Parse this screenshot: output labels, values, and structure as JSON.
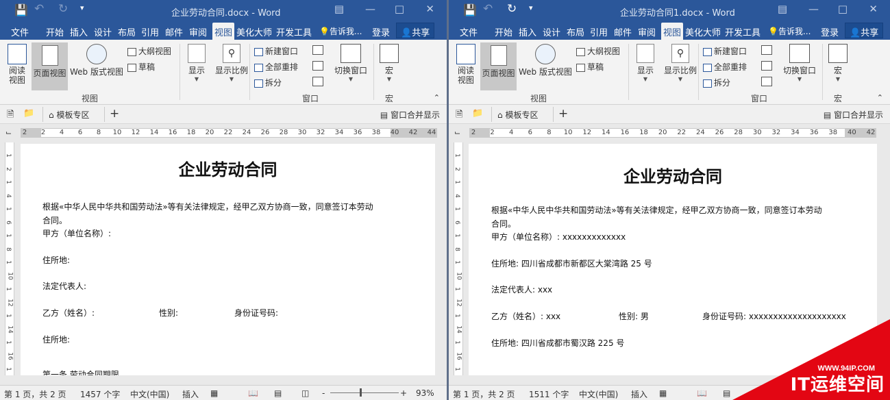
{
  "colors": {
    "brand": "#2b579a",
    "watermark": "#e30613"
  },
  "windows": [
    {
      "title": "企业劳动合同.docx - Word",
      "redo_enabled": false,
      "tabs": [
        "文件",
        "开始",
        "插入",
        "设计",
        "布局",
        "引用",
        "邮件",
        "审阅",
        "视图",
        "美化大师",
        "开发工具"
      ],
      "active_tab": "视图",
      "tell_me": "告诉我...",
      "login": "登录",
      "share": "共享",
      "ribbon": {
        "read_view": "阅读\n视图",
        "page_view": "页面视图",
        "web_view": "Web 版式视图",
        "outline": "大纲视图",
        "draft": "草稿",
        "views_group": "视图",
        "show": "显示",
        "zoom": "显示比例",
        "new_window": "新建窗口",
        "arrange_all": "全部重排",
        "split": "拆分",
        "switch_window": "切换窗口",
        "window_group": "窗口",
        "macro": "宏",
        "macro_group": "宏"
      },
      "docbar": {
        "template_zone": "模板专区",
        "merge": "窗口合并显示"
      },
      "ruler_ticks": [
        "2",
        "2",
        "4",
        "6",
        "8",
        "10",
        "12",
        "14",
        "16",
        "18",
        "20",
        "22",
        "24",
        "26",
        "28",
        "30",
        "32",
        "34",
        "36",
        "38",
        "40",
        "42",
        "44"
      ],
      "vruler_ticks": [
        "1",
        "2",
        "1",
        "4",
        "1",
        "6",
        "1",
        "8",
        "1",
        "10",
        "1",
        "12",
        "1",
        "14",
        "1",
        "16",
        "1"
      ],
      "doc": {
        "title": "企业劳动合同",
        "intro1": "根据«中华人民中华共和国劳动法»等有关法律规定，经甲乙双方协商一致，同意签订本劳动",
        "intro2": "合同。",
        "party_a": "甲方（单位名称）:",
        "address1": "住所地:",
        "legal_rep": "法定代表人:",
        "party_b": "乙方（姓名）:",
        "gender": "性别:",
        "id_no": "身份证号码:",
        "address2": "住所地:",
        "article1": "第一条 劳动合同期限"
      },
      "status": {
        "page": "第 1 页，共 2 页",
        "words": "1457 个字",
        "lang": "中文(中国)",
        "mode": "插入",
        "zoom": "93%",
        "zoom_minus": "-",
        "zoom_plus": "+"
      }
    },
    {
      "title": "企业劳动合同1.docx - Word",
      "redo_enabled": true,
      "tabs": [
        "文件",
        "开始",
        "插入",
        "设计",
        "布局",
        "引用",
        "邮件",
        "审阅",
        "视图",
        "美化大师",
        "开发工具"
      ],
      "active_tab": "视图",
      "tell_me": "告诉我...",
      "login": "登录",
      "share": "共享",
      "ribbon": {
        "read_view": "阅读\n视图",
        "page_view": "页面视图",
        "web_view": "Web 版式视图",
        "outline": "大纲视图",
        "draft": "草稿",
        "views_group": "视图",
        "show": "显示",
        "zoom": "显示比例",
        "new_window": "新建窗口",
        "arrange_all": "全部重排",
        "split": "拆分",
        "switch_window": "切换窗口",
        "window_group": "窗口",
        "macro": "宏",
        "macro_group": "宏"
      },
      "docbar": {
        "template_zone": "模板专区",
        "merge": "窗口合并显示"
      },
      "ruler_ticks": [
        "2",
        "2",
        "4",
        "6",
        "8",
        "10",
        "12",
        "14",
        "16",
        "18",
        "20",
        "22",
        "24",
        "26",
        "28",
        "30",
        "32",
        "34",
        "36",
        "38",
        "40",
        "42"
      ],
      "vruler_ticks": [
        "1",
        "2",
        "1",
        "4",
        "1",
        "6",
        "1",
        "8",
        "1",
        "10",
        "1",
        "12",
        "1",
        "14",
        "1",
        "16",
        "1"
      ],
      "doc": {
        "title": "企业劳动合同",
        "intro1": "根据«中华人民中华共和国劳动法»等有关法律规定，经甲乙双方协商一致，同意签订本劳动",
        "intro2": "合同。",
        "party_a": "甲方（单位名称）: xxxxxxxxxxxxx",
        "address1": "住所地: 四川省成都市新都区大棠湾路 25 号",
        "legal_rep": "法定代表人: xxx",
        "party_b": "乙方（姓名）: xxx",
        "gender": "性别: 男",
        "id_no": "身份证号码: xxxxxxxxxxxxxxxxxxxx",
        "address2": "住所地: 四川省成都市蜀汉路 225 号",
        "article1": ""
      },
      "status": {
        "page": "第 1 页，共 2 页",
        "words": "1511 个字",
        "lang": "中文(中国)",
        "mode": "插入",
        "zoom": "",
        "zoom_minus": "",
        "zoom_plus": ""
      }
    }
  ],
  "watermark": {
    "url": "WWW.94IP.COM",
    "text": "IT运维空间"
  }
}
